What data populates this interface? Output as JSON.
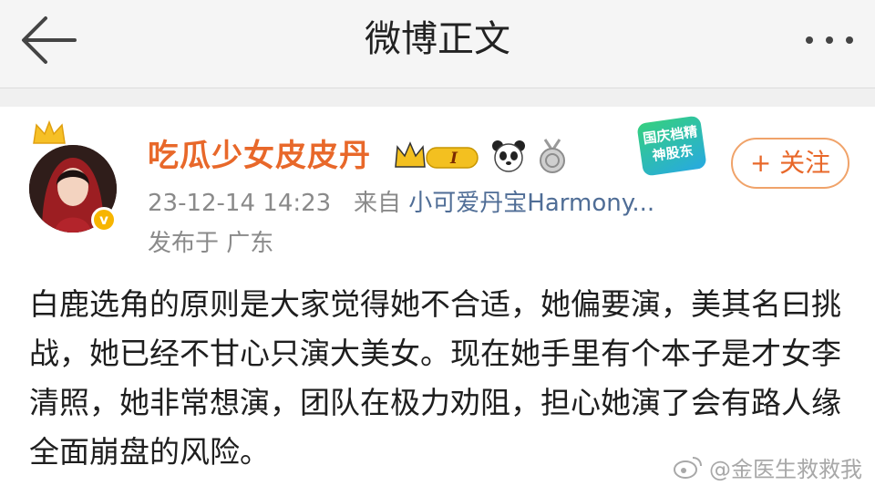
{
  "header": {
    "title": "微博正文"
  },
  "icons": {
    "back": "arrow-left-icon",
    "more": "more-dots-icon",
    "crown": "crown-icon",
    "verified": "verified-badge-icon"
  },
  "post": {
    "author": "吃瓜少女皮皮丹",
    "verified_mark": "v",
    "level_badge": "I",
    "timestamp": "23-12-14 14:23",
    "source_prefix": "来自",
    "source": "小可爱丹宝Harmony...",
    "location": "发布于 广东",
    "follow_label": "+ 关注",
    "promo_label": "国庆档精神股东",
    "text": "白鹿选角的原则是大家觉得她不合适，她偏要演，美其名曰挑战，她已经不甘心只演大美女。现在她手里有个本子是才女李清照，她非常想演，团队在极力劝阻，担心她演了会有路人缘全面崩盘的风险。"
  },
  "watermark": {
    "text": "@金医生救救我"
  },
  "colors": {
    "accent": "#e8682a",
    "link": "#4f6d96",
    "meta": "#8a8a8a",
    "verified": "#f7b500"
  }
}
